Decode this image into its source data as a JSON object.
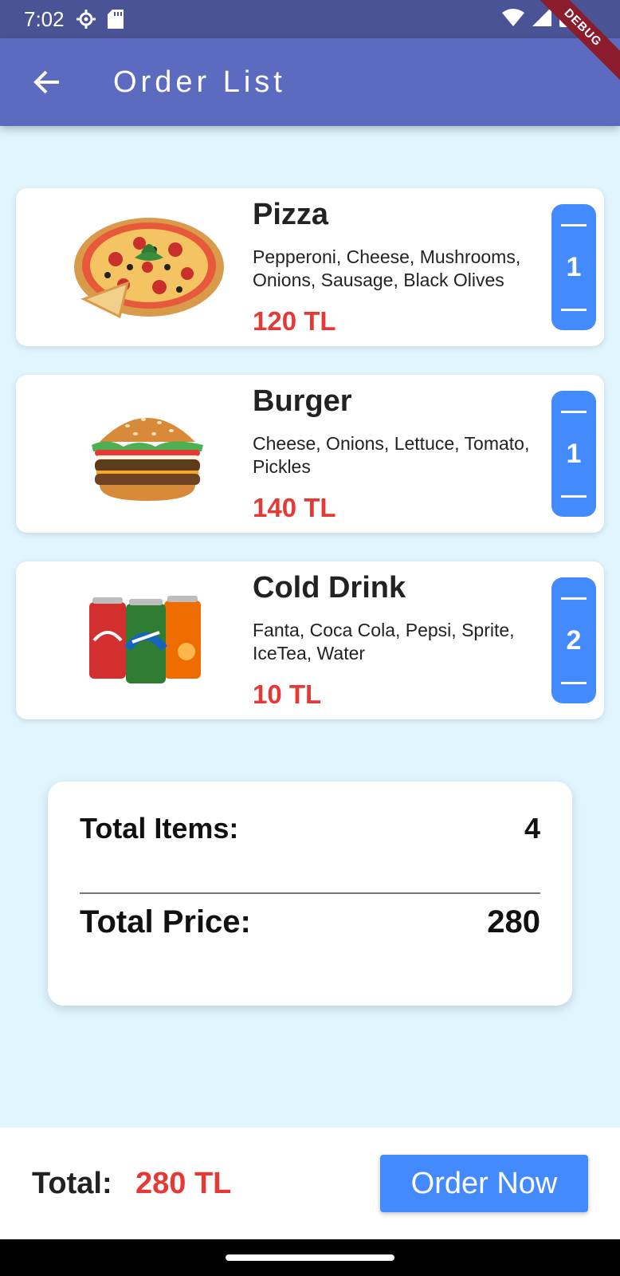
{
  "status_bar": {
    "time": "7:02"
  },
  "debug_ribbon": "DEBUG",
  "app_bar": {
    "title": "Order List"
  },
  "items": [
    {
      "name": "Pizza",
      "description": "Pepperoni, Cheese, Mushrooms, Onions, Sausage, Black Olives",
      "price": "120 TL",
      "quantity": "1",
      "image": "pizza-image"
    },
    {
      "name": "Burger",
      "description": "Cheese, Onions, Lettuce, Tomato, Pickles",
      "price": "140 TL",
      "quantity": "1",
      "image": "burger-image"
    },
    {
      "name": "Cold Drink",
      "description": "Fanta, Coca Cola, Pepsi, Sprite, IceTea, Water",
      "price": "10 TL",
      "quantity": "2",
      "image": "soda-cans-image"
    }
  ],
  "summary": {
    "items_label": "Total Items:",
    "items_value": "4",
    "price_label": "Total Price:",
    "price_value": "280"
  },
  "bottom_bar": {
    "total_label": "Total:",
    "total_value": "280 TL",
    "order_button": "Order Now"
  },
  "colors": {
    "app_bar": "#5c6bc0",
    "accent": "#448aff",
    "price": "#e53935",
    "background": "#e1f5fe"
  }
}
